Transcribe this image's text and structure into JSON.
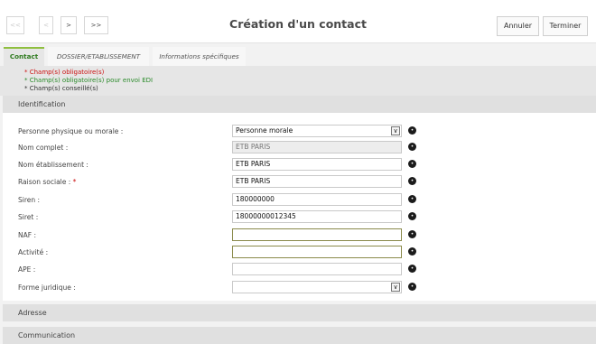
{
  "header": {
    "title": "Création d'un contact",
    "nav": {
      "first": "<<",
      "prev": "<",
      "next": ">",
      "last": ">>"
    },
    "cancel_label": "Annuler",
    "finish_label": "Terminer"
  },
  "tabs": [
    {
      "label": "Contact"
    },
    {
      "label": "DOSSIER/ETABLISSEMENT"
    },
    {
      "label": "Informations spécifiques"
    }
  ],
  "legend": {
    "mandatory": "* Champ(s) obligatoire(s)",
    "edi": "* Champ(s) obligatoire(s) pour envoi EDI",
    "advised": "* Champ(s) conseillé(s)"
  },
  "sections": {
    "identification": "Identification",
    "adresse": "Adresse",
    "communication": "Communication"
  },
  "fields": {
    "personne": {
      "label": "Personne physique ou morale :",
      "value": "Personne morale"
    },
    "nom_complet": {
      "label": "Nom complet :",
      "value": "ETB PARIS"
    },
    "nom_etab": {
      "label": "Nom établissement :",
      "value": "ETB PARIS"
    },
    "raison": {
      "label": "Raison sociale :",
      "required": "*",
      "value": "ETB PARIS"
    },
    "siren": {
      "label": "Siren :",
      "value": "180000000"
    },
    "siret": {
      "label": "Siret :",
      "value": "18000000012345"
    },
    "naf": {
      "label": "NAF :",
      "value": ""
    },
    "activite": {
      "label": "Activité :",
      "value": ""
    },
    "ape": {
      "label": "APE :",
      "value": ""
    },
    "forme": {
      "label": "Forme juridique :",
      "value": ""
    }
  },
  "icons": {
    "info": "info-circle-icon",
    "dropdown": "chevron-down-icon"
  },
  "colors": {
    "required": "#cc1111",
    "edi": "#2a8a2a",
    "active_tab": "#2e7a1e"
  }
}
